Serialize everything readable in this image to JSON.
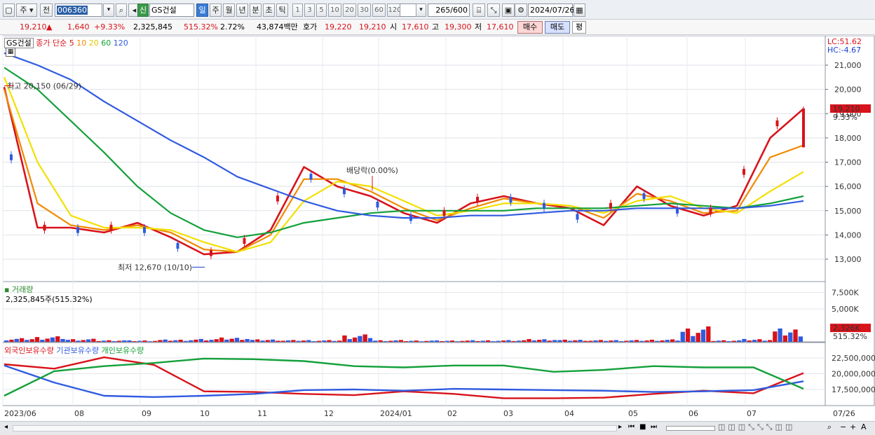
{
  "toolbar": {
    "market": "주",
    "prev_label": "전",
    "code": "006360",
    "name": "GS건설",
    "period_buttons": [
      "일",
      "주",
      "월",
      "년",
      "분",
      "초",
      "틱"
    ],
    "minute_buttons": [
      "1",
      "3",
      "5",
      "10",
      "20",
      "30",
      "60",
      "120"
    ],
    "count": "265",
    "count_max": "/600",
    "date": "2024/07/26"
  },
  "infobar": {
    "price": "19,210",
    "change_arrow": "▲",
    "change": "1,640",
    "change_pct": "+9.33%",
    "volume": "2,325,845",
    "volume_pct": "515.32%",
    "turnover": "2.72%",
    "amount": "43,874백만",
    "quote_label": "호가",
    "ask": "19,220",
    "bid": "19,210",
    "open_label": "시",
    "open": "17,610",
    "high_label": "고",
    "high": "19,300",
    "low_label": "저",
    "low": "17,610",
    "buy": "매수",
    "sell": "매도",
    "pyeong": "평"
  },
  "price_panel": {
    "stock_label": "GS건설",
    "ma_legend_prefix": "종가 단순",
    "ma_periods": [
      "5",
      "10",
      "20",
      "60",
      "120"
    ],
    "ma_colors": [
      "#d8131b",
      "#f08a00",
      "#f2e000",
      "#13a03a",
      "#2f5be0"
    ],
    "lc": "LC:51.62",
    "hc": "HC:-4.67",
    "y_ticks": [
      "21,000",
      "20,000",
      "19,000",
      "18,000",
      "17,000",
      "16,000",
      "15,000",
      "14,000",
      "13,000"
    ],
    "current_price_tag": "19,210",
    "current_pct_tag": "9.33%",
    "high_note": "최고 20,150 (06/29)",
    "low_note": "최저 12,670 (10/10)",
    "dividend_note": "배당락(0.00%)"
  },
  "volume_panel": {
    "title": "거래량",
    "value_text": "2,325,845주(515.32%)",
    "y_ticks": [
      "7,500K",
      "5,000K"
    ],
    "current_tag": "2,326K",
    "current_pct": "515.32%"
  },
  "holding_panel": {
    "legend": [
      "외국인보유수량",
      "기관보유수량",
      "개인보유수량"
    ],
    "colors": [
      "#d8131b",
      "#2f5be0",
      "#13a03a"
    ],
    "y_ticks": [
      "22,500,000",
      "20,000,000",
      "17,500,000"
    ]
  },
  "x_axis": {
    "labels": [
      "2023/06",
      "08",
      "09",
      "10",
      "11",
      "12",
      "2024/01",
      "02",
      "03",
      "04",
      "05",
      "06",
      "07",
      "07/26"
    ]
  },
  "chart_data": {
    "type": "line",
    "y_range": [
      12670,
      20150
    ],
    "high": {
      "value": 20150,
      "date": "06/29"
    },
    "low": {
      "value": 12670,
      "date": "10/10"
    },
    "last_close": 19210,
    "series": [
      {
        "name": "5",
        "values": [
          20100,
          14300,
          14300,
          14100,
          14500,
          13900,
          13200,
          13300,
          14200,
          16800,
          16000,
          15600,
          14900,
          14500,
          15300,
          15600,
          15300,
          15100,
          14400,
          16000,
          15200,
          14800,
          15200,
          18000,
          19200
        ]
      },
      {
        "name": "10",
        "values": [
          20000,
          15300,
          14400,
          14200,
          14400,
          14100,
          13400,
          13300,
          14000,
          16300,
          16300,
          15800,
          15100,
          14600,
          15100,
          15500,
          15300,
          15200,
          14700,
          15700,
          15400,
          14900,
          15000,
          17200,
          17700
        ]
      },
      {
        "name": "20",
        "values": [
          20500,
          17000,
          14800,
          14300,
          14300,
          14200,
          13700,
          13300,
          13700,
          15400,
          16200,
          16000,
          15400,
          14800,
          15000,
          15300,
          15300,
          15200,
          14900,
          15400,
          15600,
          15100,
          14900,
          15800,
          16600
        ]
      },
      {
        "name": "60",
        "values": [
          20900,
          20000,
          18700,
          17400,
          16000,
          14900,
          14200,
          13900,
          14100,
          14500,
          14700,
          14900,
          15000,
          15000,
          15000,
          15000,
          15100,
          15100,
          15100,
          15200,
          15300,
          15200,
          15100,
          15300,
          15600
        ]
      },
      {
        "name": "120",
        "values": [
          21500,
          21000,
          20400,
          19500,
          18700,
          17900,
          17200,
          16400,
          15900,
          15400,
          15000,
          14800,
          14700,
          14700,
          14800,
          14800,
          14900,
          15000,
          15000,
          15100,
          15100,
          15100,
          15100,
          15200,
          15400
        ]
      }
    ],
    "holdings": {
      "labels": [
        "외국인보유수량",
        "기관보유수량",
        "개인보유수량"
      ],
      "foreign": [
        21500000,
        20800000,
        22600000,
        21400000,
        17200000,
        17100000,
        16800000,
        16600000,
        17200000,
        16800000,
        16100000,
        16100000,
        16200000,
        16800000,
        17300000,
        16900000,
        20100000
      ],
      "institution": [
        21300000,
        18600000,
        16500000,
        16300000,
        16500000,
        16800000,
        17400000,
        17500000,
        17300000,
        17600000,
        17500000,
        17400000,
        17300000,
        17100000,
        17200000,
        17400000,
        18800000
      ],
      "individual": [
        16500000,
        20400000,
        21200000,
        21700000,
        22400000,
        22300000,
        22000000,
        21200000,
        21000000,
        21300000,
        21300000,
        20300000,
        20600000,
        21200000,
        21000000,
        21000000,
        17600000
      ]
    },
    "volume_k": [
      600,
      900,
      500,
      300,
      250,
      400,
      500,
      700,
      400,
      300,
      280,
      1200,
      300,
      250,
      250,
      280,
      300,
      450,
      350,
      300,
      300,
      400,
      2500,
      300,
      500,
      2326
    ]
  }
}
